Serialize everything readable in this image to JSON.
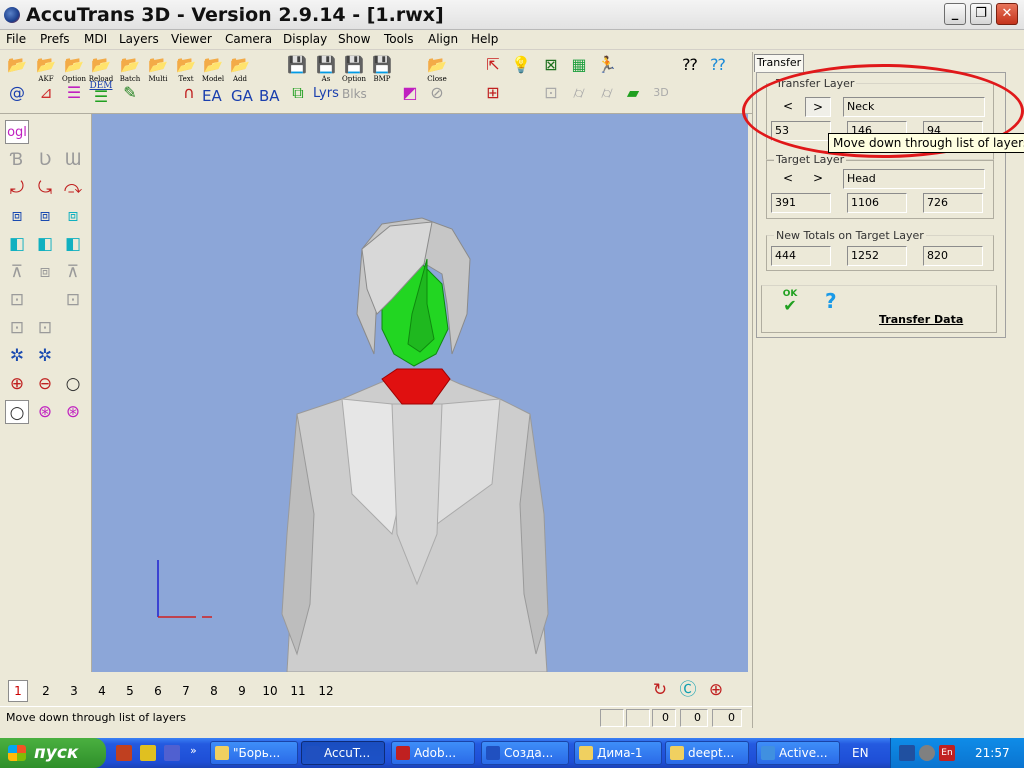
{
  "window": {
    "title": "AccuTrans 3D - Version 2.9.14 - [1.rwx]",
    "minimize": "_",
    "maximize": "❐",
    "close": "✕"
  },
  "menu": [
    "File",
    "Prefs",
    "MDI",
    "Layers",
    "Viewer",
    "Camera",
    "Display",
    "Show",
    "Tools",
    "Align",
    "Help"
  ],
  "toolbar": {
    "row1_labels": [
      "AKF",
      "Option",
      "Reload",
      "Batch",
      "Multi",
      "Text",
      "Model",
      "Add",
      "As",
      "Option",
      "BMP",
      "Close"
    ],
    "dem": "DEM",
    "ea": "EA",
    "ga": "GA",
    "ba": "BA",
    "lyrs": "Lyrs",
    "blks": "Blks",
    "b3d": "3D"
  },
  "left_tools": {
    "ogl": "ogl",
    "zoom_in": "+",
    "zoom_out": "−"
  },
  "layer_numbers": [
    "1",
    "2",
    "3",
    "4",
    "5",
    "6",
    "7",
    "8",
    "9",
    "10",
    "11",
    "12"
  ],
  "active_layer": "1",
  "status": {
    "text": "Move down through list of layers",
    "cells": [
      "0",
      "0",
      "0"
    ]
  },
  "panel": {
    "tab": "Transfer",
    "transfer_layer": {
      "label": "Transfer Layer",
      "prev": "<",
      "next": ">",
      "name": "Neck",
      "values": [
        "53",
        "146",
        "94"
      ]
    },
    "target_layer": {
      "label": "Target Layer",
      "prev": "<",
      "next": ">",
      "name": "Head",
      "values": [
        "391",
        "1106",
        "726"
      ]
    },
    "new_totals": {
      "label": "New Totals on Target Layer",
      "values": [
        "444",
        "1252",
        "820"
      ]
    },
    "ok": "OK",
    "help": "?",
    "transfer_data": "Transfer Data"
  },
  "tooltip": "Move down through list of layers",
  "taskbar": {
    "start": "пуск",
    "tasks": [
      "\"Борь...",
      "AccuT...",
      "Adob...",
      "Созда...",
      "Дима-1",
      "deept...",
      "Active..."
    ],
    "lang": "EN",
    "tray_lang": "En",
    "clock": "21:57"
  },
  "colors": {
    "viewport_bg": "#8ca6d8",
    "head_highlight": "#22d622",
    "neck_highlight": "#e01010",
    "annotation": "#e0181a"
  }
}
